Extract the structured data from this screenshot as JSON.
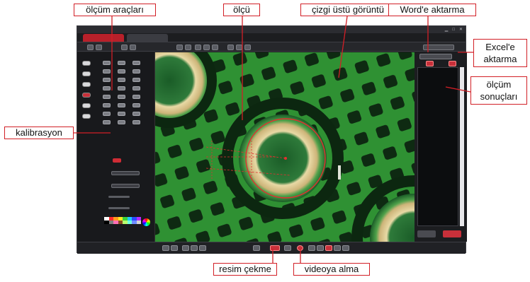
{
  "callouts": {
    "measurement_tools": "ölçüm araçları",
    "measurement": "ölçü",
    "overlay_image": "çizgi üstü görüntü",
    "export_word": "Word'e aktarma",
    "export_excel": "Excel'e aktarma",
    "measurement_results": "ölçüm sonuçları",
    "calibration": "kalibrasyon",
    "capture_image": "resim çekme",
    "record_video": "videoya alma"
  },
  "colors": {
    "callout_border": "#d21f26",
    "accent_red": "#c8303a",
    "board_green": "#2b8a2e",
    "measure_line": "#e23030"
  },
  "icons": [
    "minimize-icon",
    "maximize-icon",
    "close-icon",
    "word-export-icon",
    "excel-export-icon",
    "camera-icon",
    "record-icon",
    "color-wheel-icon"
  ]
}
